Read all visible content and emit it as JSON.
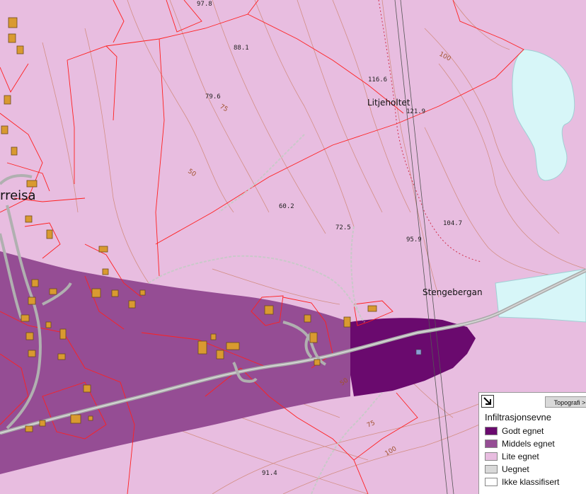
{
  "map": {
    "place_names": {
      "town_fragment": "rreisa",
      "litjeholtet": "Litjeholtet",
      "stengebergan": "Stengebergan"
    },
    "spot_heights": [
      "97.8",
      "88.1",
      "79.6",
      "116.6",
      "121.9",
      "60.2",
      "72.5",
      "104.7",
      "95.9",
      "91.4"
    ],
    "contour_labels": [
      "100",
      "75",
      "50",
      "50",
      "75",
      "100"
    ],
    "colors": {
      "godt": "#6a0a6e",
      "middels": "#954d94",
      "lite": "#e8bde0",
      "uegnet": "#d9d9d9",
      "ikke": "#ffffff",
      "water": "#d7f6f8",
      "property_line": "#ff2020",
      "contour": "#d08a7a",
      "road": "#b5b5b5",
      "building": "#d99a30"
    }
  },
  "legend": {
    "toggle_icon": "collapse-arrow-icon",
    "tab_label": "Topografi >",
    "title": "Infiltrasjonsevne",
    "items": [
      {
        "label": "Godt egnet",
        "color": "#6a0a6e"
      },
      {
        "label": "Middels egnet",
        "color": "#954d94"
      },
      {
        "label": "Lite egnet",
        "color": "#e8bde0"
      },
      {
        "label": "Uegnet",
        "color": "#d9d9d9"
      },
      {
        "label": "Ikke klassifisert",
        "color": "#ffffff"
      }
    ]
  }
}
